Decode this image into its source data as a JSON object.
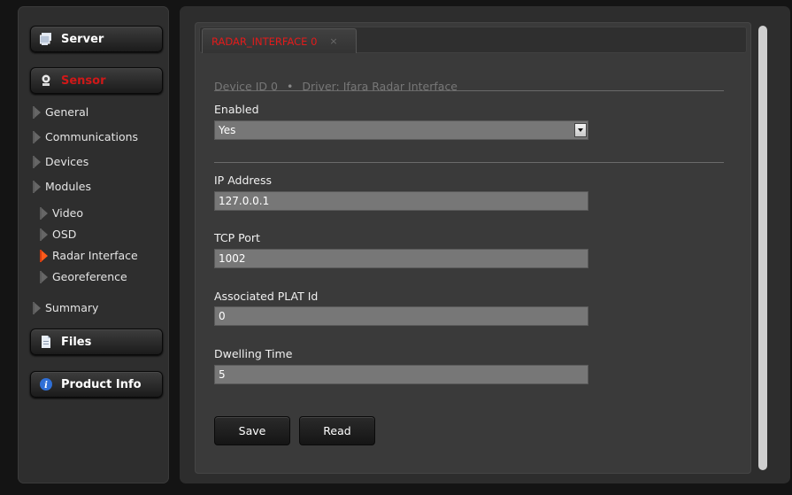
{
  "sidebar": {
    "server_label": "Server",
    "sensor_label": "Sensor",
    "items": [
      {
        "label": "General"
      },
      {
        "label": "Communications"
      },
      {
        "label": "Devices"
      },
      {
        "label": "Modules"
      }
    ],
    "modules": [
      {
        "label": "Video"
      },
      {
        "label": "OSD"
      },
      {
        "label": "Radar Interface"
      },
      {
        "label": "Georeference"
      }
    ],
    "summary_label": "Summary",
    "files_label": "Files",
    "product_info_label": "Product Info"
  },
  "tab": {
    "label": "RADAR_INTERFACE 0",
    "close": "×"
  },
  "form": {
    "device_id": "Device ID 0",
    "bullet": "•",
    "driver": "Driver: Ifara Radar Interface",
    "enabled_label": "Enabled",
    "enabled_value": "Yes",
    "ip_label": "IP Address",
    "ip_value": "127.0.0.1",
    "port_label": "TCP Port",
    "port_value": "1002",
    "plat_label": "Associated PLAT Id",
    "plat_value": "0",
    "dwell_label": "Dwelling Time",
    "dwell_value": "5",
    "save_label": "Save",
    "read_label": "Read"
  },
  "colors": {
    "accent_red": "#d01818",
    "active_arrow": "#ff5a1a"
  }
}
